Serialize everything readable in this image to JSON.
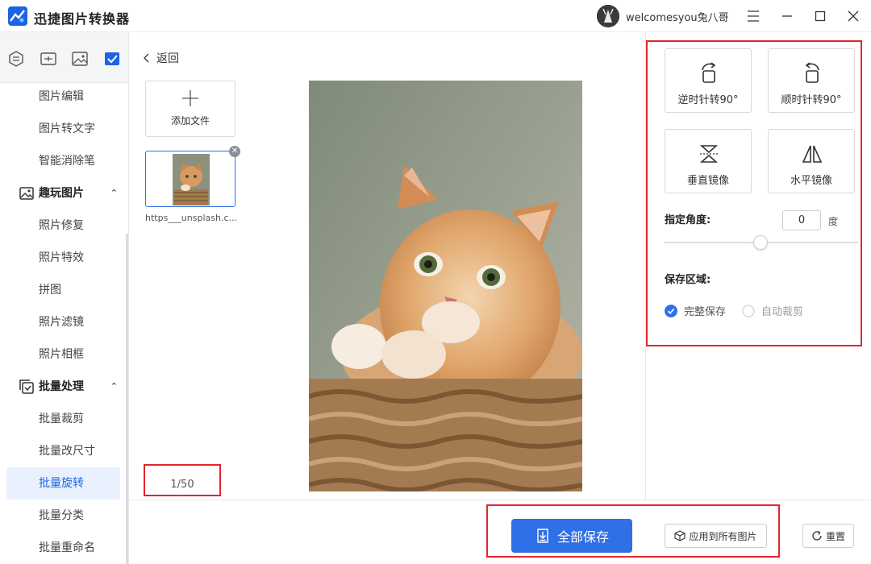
{
  "app": {
    "title": "迅捷图片转换器",
    "username": "welcomesyou兔八哥"
  },
  "colors": {
    "accent": "#2f6fe8",
    "highlight": "#e3262b",
    "active_bg": "#e9f1fe"
  },
  "sidebar": {
    "items": [
      {
        "label": "图片编辑"
      },
      {
        "label": "图片转文字"
      },
      {
        "label": "智能消除笔"
      },
      {
        "label": "趣玩图片",
        "group": true
      },
      {
        "label": "照片修复"
      },
      {
        "label": "照片特效"
      },
      {
        "label": "拼图"
      },
      {
        "label": "照片滤镜"
      },
      {
        "label": "照片相框"
      },
      {
        "label": "批量处理",
        "group": true
      },
      {
        "label": "批量裁剪"
      },
      {
        "label": "批量改尺寸"
      },
      {
        "label": "批量旋转",
        "active": true
      },
      {
        "label": "批量分类"
      },
      {
        "label": "批量重命名"
      }
    ]
  },
  "main": {
    "back_label": "返回",
    "add_file_label": "添加文件",
    "thumb_name": "https___unsplash.c...",
    "page_count": "1/50"
  },
  "panel": {
    "ops": [
      {
        "label": "逆时针转90°",
        "icon": "rotate-ccw-icon"
      },
      {
        "label": "顺时针转90°",
        "icon": "rotate-cw-icon"
      },
      {
        "label": "垂直镜像",
        "icon": "flip-vertical-icon"
      },
      {
        "label": "水平镜像",
        "icon": "flip-horizontal-icon"
      }
    ],
    "angle_label": "指定角度:",
    "angle_value": "0",
    "angle_unit": "度",
    "angle_slider_fraction": 0.5,
    "save_area_label": "保存区域:",
    "save_options": [
      {
        "label": "完整保存",
        "checked": true
      },
      {
        "label": "自动裁剪",
        "checked": false
      }
    ]
  },
  "footer": {
    "save_all": "全部保存",
    "apply_all": "应用到所有图片",
    "reset": "重置"
  }
}
